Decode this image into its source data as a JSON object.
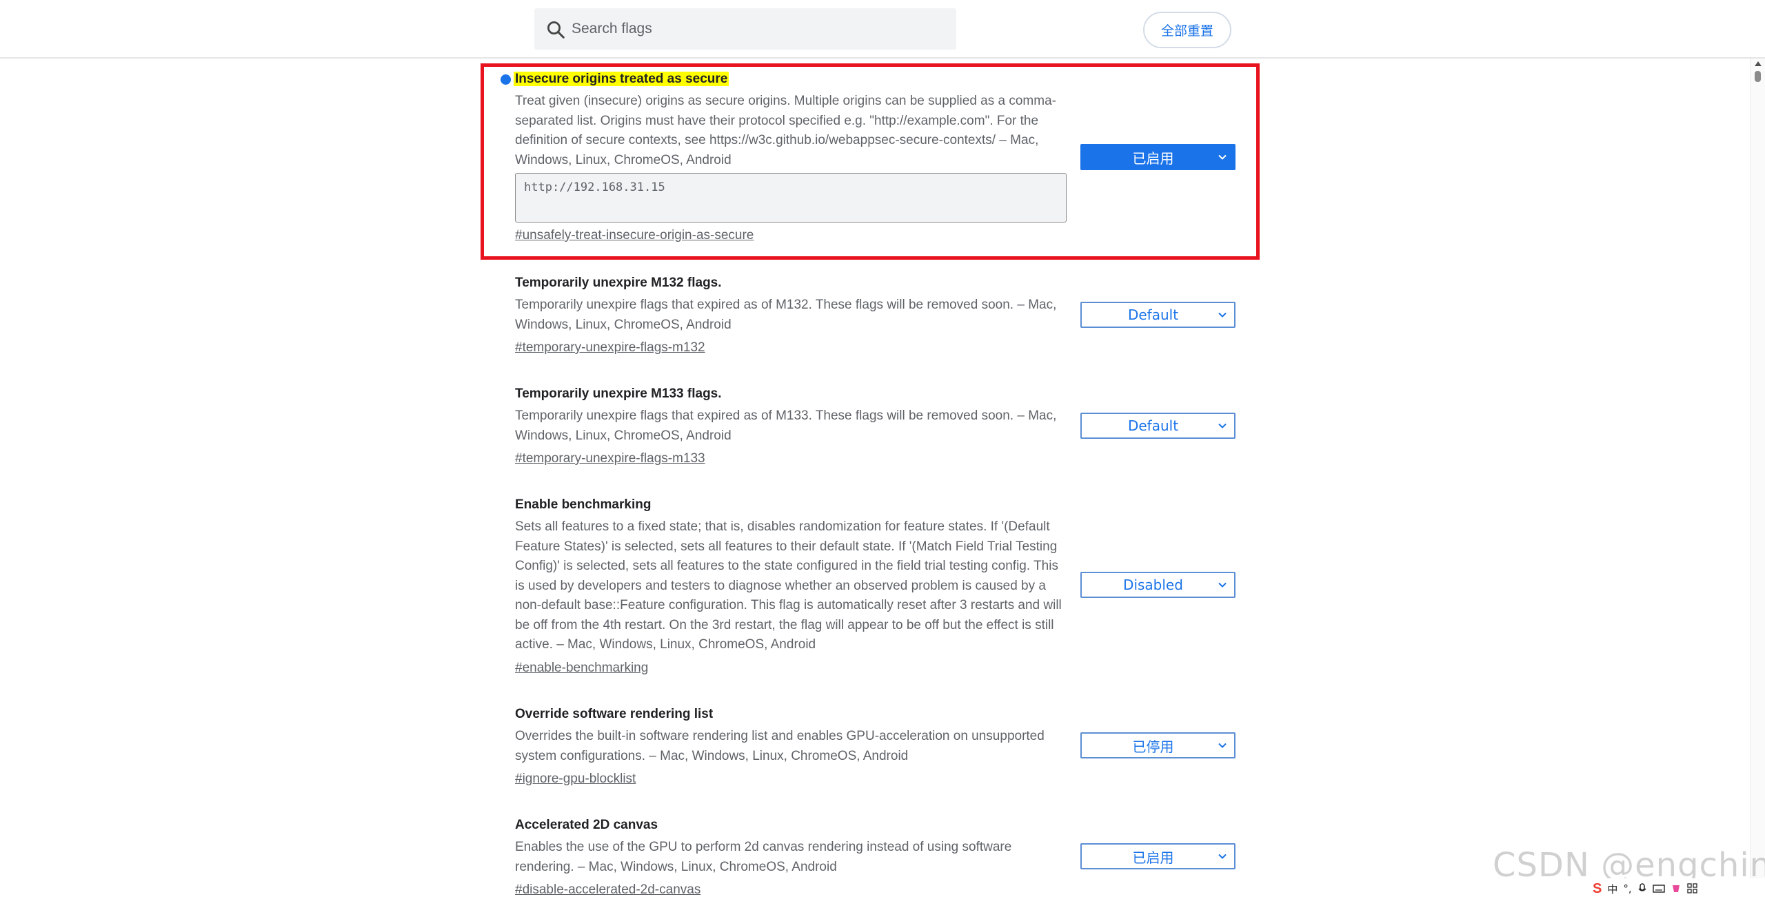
{
  "header": {
    "search_placeholder": "Search flags",
    "reset_all_label": "全部重置"
  },
  "experiments": [
    {
      "title": "Insecure origins treated as secure",
      "description": "Treat given (insecure) origins as secure origins. Multiple origins can be supplied as a comma-separated list. Origins must have their protocol specified e.g. \"http://example.com\". For the definition of secure contexts, see https://w3c.github.io/webappsec-secure-contexts/ – Mac, Windows, Linux, ChromeOS, Android",
      "textarea_value": "http://192.168.31.15",
      "link": "#unsafely-treat-insecure-origin-as-secure",
      "select_value": "已启用",
      "highlighted": true
    },
    {
      "title": "Temporarily unexpire M132 flags.",
      "description": "Temporarily unexpire flags that expired as of M132. These flags will be removed soon. – Mac, Windows, Linux, ChromeOS, Android",
      "link": "#temporary-unexpire-flags-m132",
      "select_value": "Default"
    },
    {
      "title": "Temporarily unexpire M133 flags.",
      "description": "Temporarily unexpire flags that expired as of M133. These flags will be removed soon. – Mac, Windows, Linux, ChromeOS, Android",
      "link": "#temporary-unexpire-flags-m133",
      "select_value": "Default"
    },
    {
      "title": "Enable benchmarking",
      "description": "Sets all features to a fixed state; that is, disables randomization for feature states. If '(Default Feature States)' is selected, sets all features to their default state. If '(Match Field Trial Testing Config)' is selected, sets all features to the state configured in the field trial testing config. This is used by developers and testers to diagnose whether an observed problem is caused by a non-default base::Feature configuration. This flag is automatically reset after 3 restarts and will be off from the 4th restart. On the 3rd restart, the flag will appear to be off but the effect is still active. – Mac, Windows, Linux, ChromeOS, Android",
      "link": "#enable-benchmarking",
      "select_value": "Disabled"
    },
    {
      "title": "Override software rendering list",
      "description": "Overrides the built-in software rendering list and enables GPU-acceleration on unsupported system configurations. – Mac, Windows, Linux, ChromeOS, Android",
      "link": "#ignore-gpu-blocklist",
      "select_value": "已停用"
    },
    {
      "title": "Accelerated 2D canvas",
      "description": "Enables the use of the GPU to perform 2d canvas rendering instead of using software rendering. – Mac, Windows, Linux, ChromeOS, Android",
      "link": "#disable-accelerated-2d-canvas",
      "select_value": "已启用"
    }
  ],
  "watermark": "CSDN @engchina",
  "tray": {
    "ime_label": "中",
    "ime_punct": "°,"
  },
  "colors": {
    "accent": "#1a73e8",
    "highlight_box": "#e8131e",
    "title_highlight": "#ffff00"
  }
}
